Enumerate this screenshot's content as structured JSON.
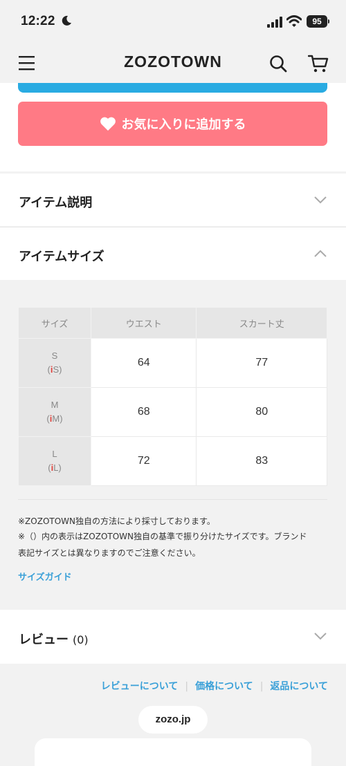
{
  "status": {
    "time": "12:22",
    "battery": "95"
  },
  "nav": {
    "logo": "ZOZOTOWN"
  },
  "favorite_button": "お気に入りに追加する",
  "sections": {
    "item_description": "アイテム説明",
    "item_size": "アイテムサイズ"
  },
  "size_table": {
    "headers": [
      "サイズ",
      "ウエスト",
      "スカート丈"
    ],
    "rows": [
      {
        "size": "S",
        "size_sub": "S",
        "waist": "64",
        "length": "77"
      },
      {
        "size": "M",
        "size_sub": "M",
        "waist": "68",
        "length": "80"
      },
      {
        "size": "L",
        "size_sub": "L",
        "waist": "72",
        "length": "83"
      }
    ]
  },
  "notes": {
    "line1": "※ZOZOTOWN独自の方法により採寸しております。",
    "line2": "※（）内の表示はZOZOTOWN独自の基準で振り分けたサイズです。ブランド",
    "line3": "表記サイズとは異なりますのでご注意ください。"
  },
  "size_guide": "サイズガイド",
  "review": {
    "label": "レビュー",
    "count": "(0)"
  },
  "footer": {
    "links": [
      "レビューについて",
      "価格について",
      "返品について"
    ],
    "domain": "zozo.jp"
  },
  "colors": {
    "favorite": "#ff7a85",
    "link": "#3aa0d8",
    "accent_blue": "#29abe2"
  }
}
